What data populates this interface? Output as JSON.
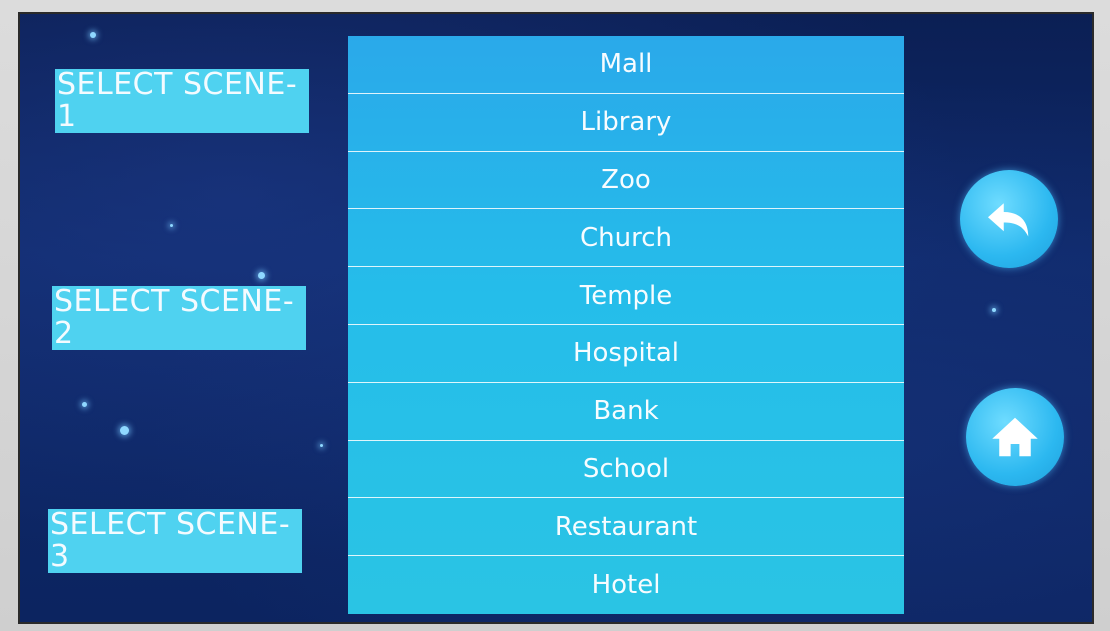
{
  "left_panel": {
    "scene_labels": [
      {
        "text": "SELECT SCENE-",
        "num": "1"
      },
      {
        "text": "SELECT SCENE-",
        "num": "2"
      },
      {
        "text": "SELECT SCENE-",
        "num": "3"
      }
    ]
  },
  "scene_list": {
    "items": [
      "Mall",
      "Library",
      "Zoo",
      "Church",
      "Temple",
      "Hospital",
      "Bank",
      "School",
      "Restaurant",
      "Hotel"
    ]
  },
  "right_panel": {
    "back_icon": "back-arrow-icon",
    "home_icon": "home-icon"
  },
  "colors": {
    "accent": "#4fd2f0",
    "list_bg": "#2ab4e8",
    "screen_bg": "#0f2a6b"
  }
}
